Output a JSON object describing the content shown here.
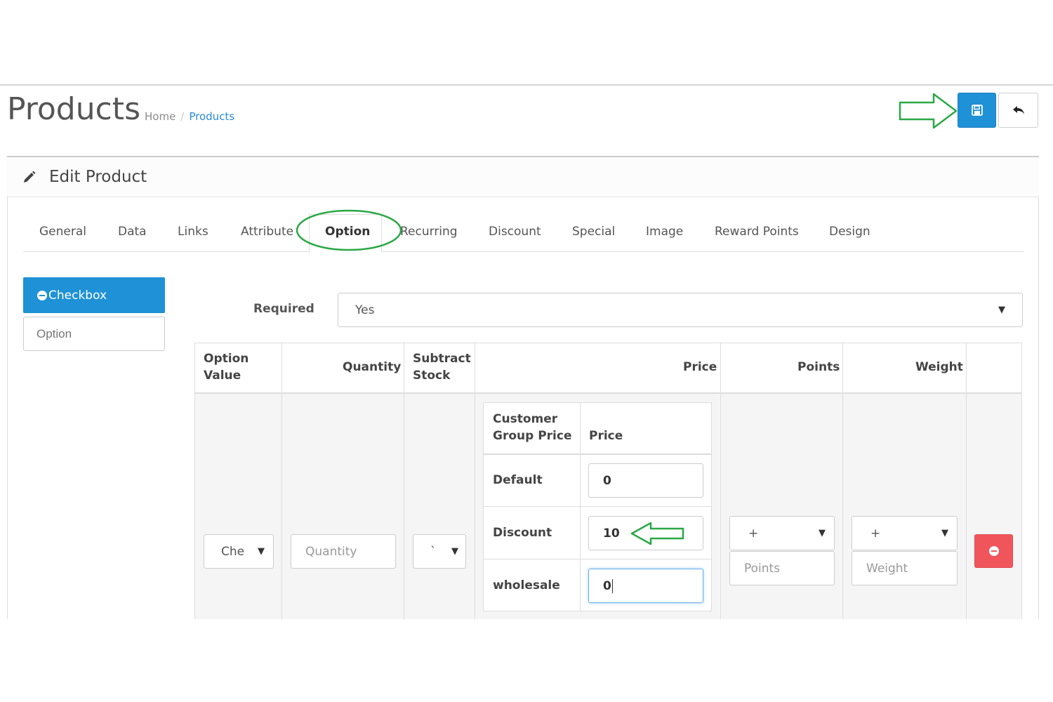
{
  "header": {
    "title": "Products",
    "breadcrumb": {
      "home": "Home",
      "separator": "/",
      "current": "Products"
    },
    "save_icon": "floppy-disk-icon",
    "back_icon": "reply-arrow-icon"
  },
  "panel": {
    "title": "Edit Product",
    "title_icon": "pencil-icon"
  },
  "tabs": [
    {
      "label": "General"
    },
    {
      "label": "Data"
    },
    {
      "label": "Links"
    },
    {
      "label": "Attribute"
    },
    {
      "label": "Option",
      "active": true
    },
    {
      "label": "Recurring"
    },
    {
      "label": "Discount"
    },
    {
      "label": "Special"
    },
    {
      "label": "Image"
    },
    {
      "label": "Reward Points"
    },
    {
      "label": "Design"
    }
  ],
  "sidebar": {
    "active_item": "Checkbox",
    "option_placeholder": "Option"
  },
  "option_form": {
    "required_label": "Required",
    "required_value": "Yes",
    "columns": {
      "option_value_1": "Option",
      "option_value_2": "Value",
      "quantity": "Quantity",
      "subtract_stock_1": "Subtract",
      "subtract_stock_2": "Stock",
      "price": "Price",
      "points": "Points",
      "weight": "Weight"
    },
    "row": {
      "option_value": "Che",
      "quantity_placeholder": "Quantity",
      "subtract_value": "`",
      "points_prefix": "+",
      "points_placeholder": "Points",
      "weight_prefix": "+",
      "weight_placeholder": "Weight"
    },
    "customer_group_table": {
      "header_group_1": "Customer",
      "header_group_2": "Group Price",
      "header_price": "Price",
      "rows": [
        {
          "group": "Default",
          "price": "0"
        },
        {
          "group": "Discount",
          "price": "10"
        },
        {
          "group": "wholesale",
          "price": "0"
        }
      ]
    }
  },
  "colors": {
    "primary": "#1f91d6",
    "danger": "#f0555c",
    "annotation": "#2aa845"
  }
}
